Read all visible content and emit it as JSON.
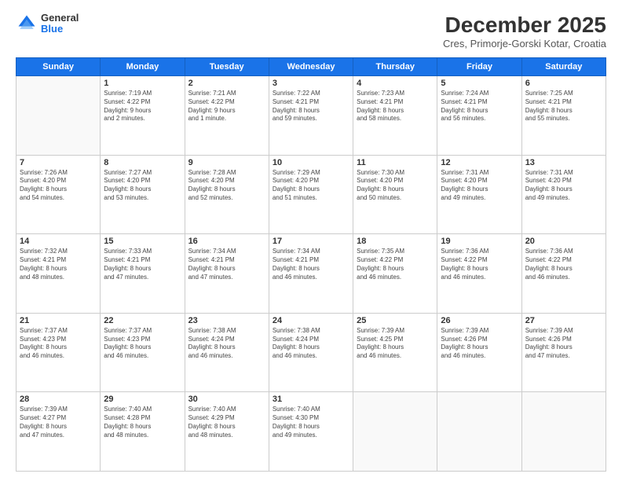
{
  "logo": {
    "general": "General",
    "blue": "Blue"
  },
  "header": {
    "title": "December 2025",
    "subtitle": "Cres, Primorje-Gorski Kotar, Croatia"
  },
  "days_of_week": [
    "Sunday",
    "Monday",
    "Tuesday",
    "Wednesday",
    "Thursday",
    "Friday",
    "Saturday"
  ],
  "weeks": [
    [
      {
        "day": "",
        "info": ""
      },
      {
        "day": "1",
        "info": "Sunrise: 7:19 AM\nSunset: 4:22 PM\nDaylight: 9 hours\nand 2 minutes."
      },
      {
        "day": "2",
        "info": "Sunrise: 7:21 AM\nSunset: 4:22 PM\nDaylight: 9 hours\nand 1 minute."
      },
      {
        "day": "3",
        "info": "Sunrise: 7:22 AM\nSunset: 4:21 PM\nDaylight: 8 hours\nand 59 minutes."
      },
      {
        "day": "4",
        "info": "Sunrise: 7:23 AM\nSunset: 4:21 PM\nDaylight: 8 hours\nand 58 minutes."
      },
      {
        "day": "5",
        "info": "Sunrise: 7:24 AM\nSunset: 4:21 PM\nDaylight: 8 hours\nand 56 minutes."
      },
      {
        "day": "6",
        "info": "Sunrise: 7:25 AM\nSunset: 4:21 PM\nDaylight: 8 hours\nand 55 minutes."
      }
    ],
    [
      {
        "day": "7",
        "info": "Sunrise: 7:26 AM\nSunset: 4:20 PM\nDaylight: 8 hours\nand 54 minutes."
      },
      {
        "day": "8",
        "info": "Sunrise: 7:27 AM\nSunset: 4:20 PM\nDaylight: 8 hours\nand 53 minutes."
      },
      {
        "day": "9",
        "info": "Sunrise: 7:28 AM\nSunset: 4:20 PM\nDaylight: 8 hours\nand 52 minutes."
      },
      {
        "day": "10",
        "info": "Sunrise: 7:29 AM\nSunset: 4:20 PM\nDaylight: 8 hours\nand 51 minutes."
      },
      {
        "day": "11",
        "info": "Sunrise: 7:30 AM\nSunset: 4:20 PM\nDaylight: 8 hours\nand 50 minutes."
      },
      {
        "day": "12",
        "info": "Sunrise: 7:31 AM\nSunset: 4:20 PM\nDaylight: 8 hours\nand 49 minutes."
      },
      {
        "day": "13",
        "info": "Sunrise: 7:31 AM\nSunset: 4:20 PM\nDaylight: 8 hours\nand 49 minutes."
      }
    ],
    [
      {
        "day": "14",
        "info": "Sunrise: 7:32 AM\nSunset: 4:21 PM\nDaylight: 8 hours\nand 48 minutes."
      },
      {
        "day": "15",
        "info": "Sunrise: 7:33 AM\nSunset: 4:21 PM\nDaylight: 8 hours\nand 47 minutes."
      },
      {
        "day": "16",
        "info": "Sunrise: 7:34 AM\nSunset: 4:21 PM\nDaylight: 8 hours\nand 47 minutes."
      },
      {
        "day": "17",
        "info": "Sunrise: 7:34 AM\nSunset: 4:21 PM\nDaylight: 8 hours\nand 46 minutes."
      },
      {
        "day": "18",
        "info": "Sunrise: 7:35 AM\nSunset: 4:22 PM\nDaylight: 8 hours\nand 46 minutes."
      },
      {
        "day": "19",
        "info": "Sunrise: 7:36 AM\nSunset: 4:22 PM\nDaylight: 8 hours\nand 46 minutes."
      },
      {
        "day": "20",
        "info": "Sunrise: 7:36 AM\nSunset: 4:22 PM\nDaylight: 8 hours\nand 46 minutes."
      }
    ],
    [
      {
        "day": "21",
        "info": "Sunrise: 7:37 AM\nSunset: 4:23 PM\nDaylight: 8 hours\nand 46 minutes."
      },
      {
        "day": "22",
        "info": "Sunrise: 7:37 AM\nSunset: 4:23 PM\nDaylight: 8 hours\nand 46 minutes."
      },
      {
        "day": "23",
        "info": "Sunrise: 7:38 AM\nSunset: 4:24 PM\nDaylight: 8 hours\nand 46 minutes."
      },
      {
        "day": "24",
        "info": "Sunrise: 7:38 AM\nSunset: 4:24 PM\nDaylight: 8 hours\nand 46 minutes."
      },
      {
        "day": "25",
        "info": "Sunrise: 7:39 AM\nSunset: 4:25 PM\nDaylight: 8 hours\nand 46 minutes."
      },
      {
        "day": "26",
        "info": "Sunrise: 7:39 AM\nSunset: 4:26 PM\nDaylight: 8 hours\nand 46 minutes."
      },
      {
        "day": "27",
        "info": "Sunrise: 7:39 AM\nSunset: 4:26 PM\nDaylight: 8 hours\nand 47 minutes."
      }
    ],
    [
      {
        "day": "28",
        "info": "Sunrise: 7:39 AM\nSunset: 4:27 PM\nDaylight: 8 hours\nand 47 minutes."
      },
      {
        "day": "29",
        "info": "Sunrise: 7:40 AM\nSunset: 4:28 PM\nDaylight: 8 hours\nand 48 minutes."
      },
      {
        "day": "30",
        "info": "Sunrise: 7:40 AM\nSunset: 4:29 PM\nDaylight: 8 hours\nand 48 minutes."
      },
      {
        "day": "31",
        "info": "Sunrise: 7:40 AM\nSunset: 4:30 PM\nDaylight: 8 hours\nand 49 minutes."
      },
      {
        "day": "",
        "info": ""
      },
      {
        "day": "",
        "info": ""
      },
      {
        "day": "",
        "info": ""
      }
    ]
  ]
}
